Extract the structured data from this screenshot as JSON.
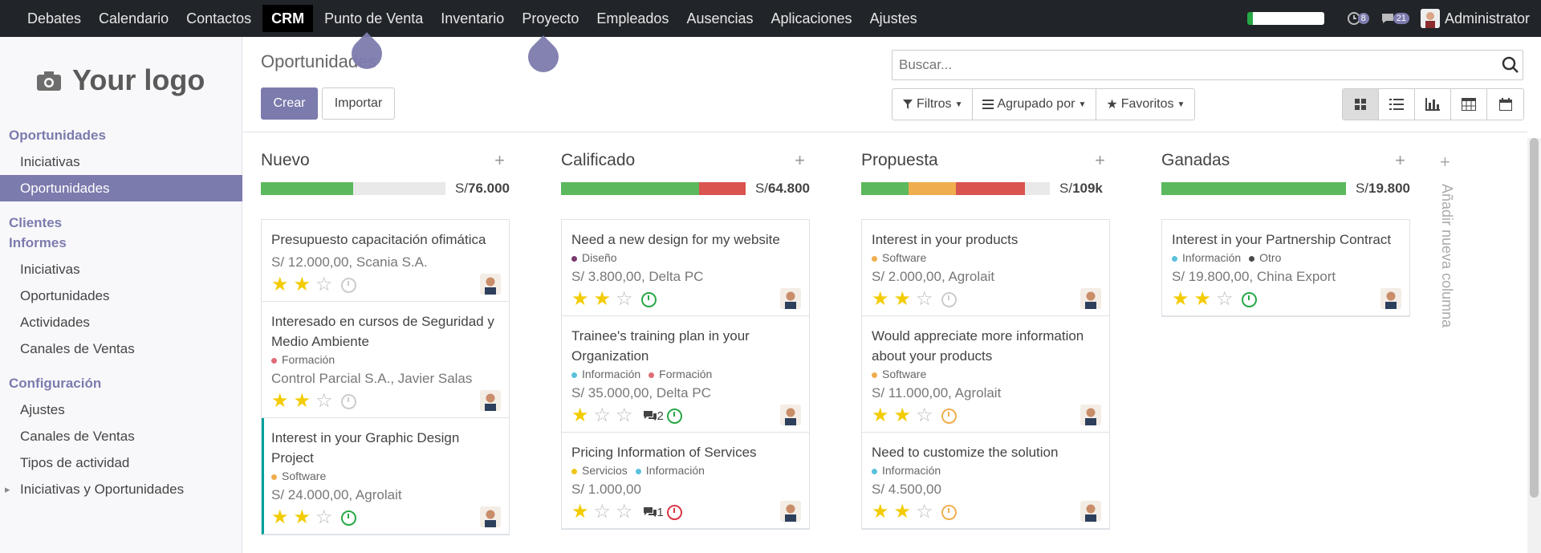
{
  "nav": {
    "apps": [
      "Debates",
      "Calendario",
      "Contactos",
      "CRM",
      "Punto de Venta",
      "Inventario",
      "Proyecto",
      "Empleados",
      "Ausencias",
      "Aplicaciones",
      "Ajustes"
    ],
    "active_app": "CRM",
    "activities_count": "8",
    "messages_count": "21",
    "user": "Administrator"
  },
  "sidebar": {
    "logo": "Your logo",
    "sections": [
      {
        "title": "Oportunidades",
        "items": [
          "Iniciativas",
          "Oportunidades"
        ]
      },
      {
        "title": "Clientes",
        "items": []
      },
      {
        "title": "Informes",
        "items": [
          "Iniciativas",
          "Oportunidades",
          "Actividades",
          "Canales de Ventas"
        ]
      },
      {
        "title": "Configuración",
        "items": [
          "Ajustes",
          "Canales de Ventas",
          "Tipos de actividad",
          "Iniciativas y Oportunidades"
        ]
      }
    ],
    "active_item": "Oportunidades"
  },
  "control": {
    "title": "Oportunidades",
    "create": "Crear",
    "import": "Importar",
    "search_placeholder": "Buscar...",
    "filters": "Filtros",
    "group_by": "Agrupado por",
    "favorites": "Favoritos"
  },
  "columns": [
    {
      "title": "Nuevo",
      "amount_prefix": "S/",
      "amount": "76.000",
      "progress": [
        {
          "color": "#5cb85c",
          "pct": 0.5
        }
      ],
      "cards": [
        {
          "title": "Presupuesto capacitación ofimática",
          "tags": [],
          "money": "S/ 12.000,00, Scania S.A.",
          "stars": 2,
          "clock": "grey"
        },
        {
          "title": "Interesado en cursos de Seguridad y Medio Ambiente",
          "tags": [
            {
              "name": "Formación",
              "color": "#e06c75"
            }
          ],
          "money": "Control Parcial S.A., Javier Salas",
          "stars": 2,
          "clock": "grey"
        },
        {
          "title": "Interest in your Graphic Design Project",
          "tags": [
            {
              "name": "Software",
              "color": "#f0ad4e"
            }
          ],
          "money": "S/ 24.000,00, Agrolait",
          "stars": 2,
          "clock": "green",
          "selected": true
        }
      ]
    },
    {
      "title": "Calificado",
      "amount_prefix": "S/",
      "amount": "64.800",
      "progress": [
        {
          "color": "#5cb85c",
          "pct": 0.75
        },
        {
          "color": "#d9534f",
          "pct": 0.25
        }
      ],
      "cards": [
        {
          "title": "Need a new design for my website",
          "tags": [
            {
              "name": "Diseño",
              "color": "#7b3b6f"
            }
          ],
          "money": "S/ 3.800,00, Delta PC",
          "stars": 2,
          "clock": "green"
        },
        {
          "title": "Trainee's training plan in your Organization",
          "tags": [
            {
              "name": "Información",
              "color": "#5bc0de"
            },
            {
              "name": "Formación",
              "color": "#e06c75"
            }
          ],
          "money": "S/ 35.000,00, Delta PC",
          "stars": 1,
          "messages": "2",
          "clock": "green"
        },
        {
          "title": "Pricing Information of Services",
          "tags": [
            {
              "name": "Servicios",
              "color": "#f0c419"
            },
            {
              "name": "Información",
              "color": "#5bc0de"
            }
          ],
          "money": "S/ 1.000,00",
          "stars": 1,
          "messages": "1",
          "clock": "red"
        }
      ]
    },
    {
      "title": "Propuesta",
      "amount_prefix": "S/",
      "amount": "109k",
      "progress": [
        {
          "color": "#5cb85c",
          "pct": 0.25
        },
        {
          "color": "#f0ad4e",
          "pct": 0.25
        },
        {
          "color": "#d9534f",
          "pct": 0.37
        }
      ],
      "cards": [
        {
          "title": "Interest in your products",
          "tags": [
            {
              "name": "Software",
              "color": "#f0ad4e"
            }
          ],
          "money": "S/ 2.000,00, Agrolait",
          "stars": 2,
          "clock": "grey"
        },
        {
          "title": "Would appreciate more information about your products",
          "tags": [
            {
              "name": "Software",
              "color": "#f0ad4e"
            }
          ],
          "money": "S/ 11.000,00, Agrolait",
          "stars": 2,
          "clock": "orange"
        },
        {
          "title": "Need to customize the solution",
          "tags": [
            {
              "name": "Información",
              "color": "#5bc0de"
            }
          ],
          "money": "S/ 4.500,00",
          "stars": 2,
          "clock": "orange"
        }
      ]
    },
    {
      "title": "Ganadas",
      "amount_prefix": "S/",
      "amount": "19.800",
      "progress": [
        {
          "color": "#5cb85c",
          "pct": 1.0
        }
      ],
      "cards": [
        {
          "title": "Interest in your Partnership Contract",
          "tags": [
            {
              "name": "Información",
              "color": "#5bc0de"
            },
            {
              "name": "Otro",
              "color": "#4a4a4a"
            }
          ],
          "money": "S/ 19.800,00, China Export",
          "stars": 2,
          "clock": "green"
        }
      ]
    }
  ],
  "add_column": "Añadir nueva columna"
}
